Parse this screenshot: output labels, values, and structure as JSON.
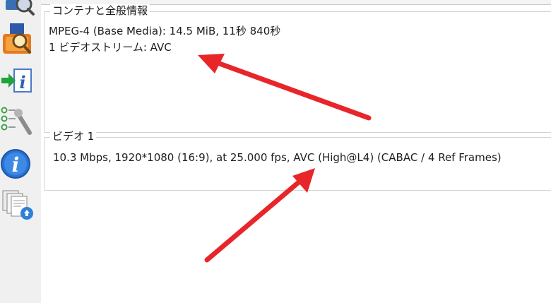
{
  "sidebar": {
    "icons": [
      {
        "name": "magnifier-icon"
      },
      {
        "name": "export-search-icon"
      },
      {
        "name": "import-info-icon"
      },
      {
        "name": "preferences-tools-icon"
      },
      {
        "name": "about-info-icon"
      },
      {
        "name": "documents-icon"
      }
    ]
  },
  "general": {
    "legend": "コンテナと全般情報",
    "line1": "MPEG-4 (Base Media): 14.5 MiB, 11秒 840秒",
    "line2": "1 ビデオストリーム: AVC"
  },
  "video": {
    "legend": "ビデオ 1",
    "line1": "10.3 Mbps, 1920*1080 (16:9), at 25.000 fps, AVC (High@L4) (CABAC / 4 Ref Frames)"
  },
  "annotations": {
    "arrow_color": "#e8262a"
  }
}
